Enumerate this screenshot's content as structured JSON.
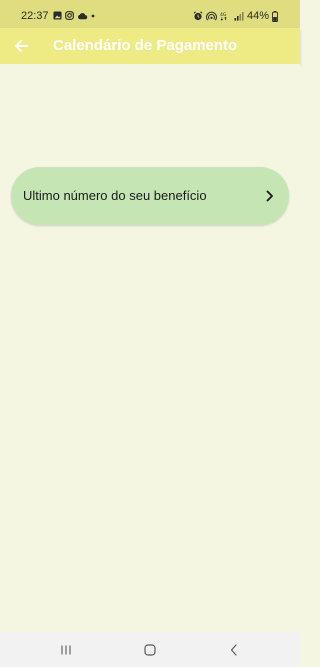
{
  "status_bar": {
    "time": "22:37",
    "battery": "44%",
    "left_icons": [
      "image-icon",
      "instagram-icon",
      "cloud-icon",
      "dot-icon"
    ],
    "right_icons": [
      "alarm-icon",
      "hotspot-icon",
      "4g-signal-icon",
      "signal-bars-icon"
    ]
  },
  "app_bar": {
    "title": "Calendário de Pagamento",
    "back_icon": "arrow-left-icon"
  },
  "main": {
    "benefit_option_label": "Ultimo número do seu benefício",
    "chevron_icon": "chevron-right-icon"
  },
  "nav_bar": {
    "items": [
      "recents-icon",
      "home-icon",
      "back-icon"
    ]
  },
  "colors": {
    "status_bar_bg": "#dfdd7f",
    "app_bar_bg": "#eeeb85",
    "page_bg": "#f5f6e2",
    "card_bg": "#c5e5b5",
    "title_text": "#ffffff"
  }
}
